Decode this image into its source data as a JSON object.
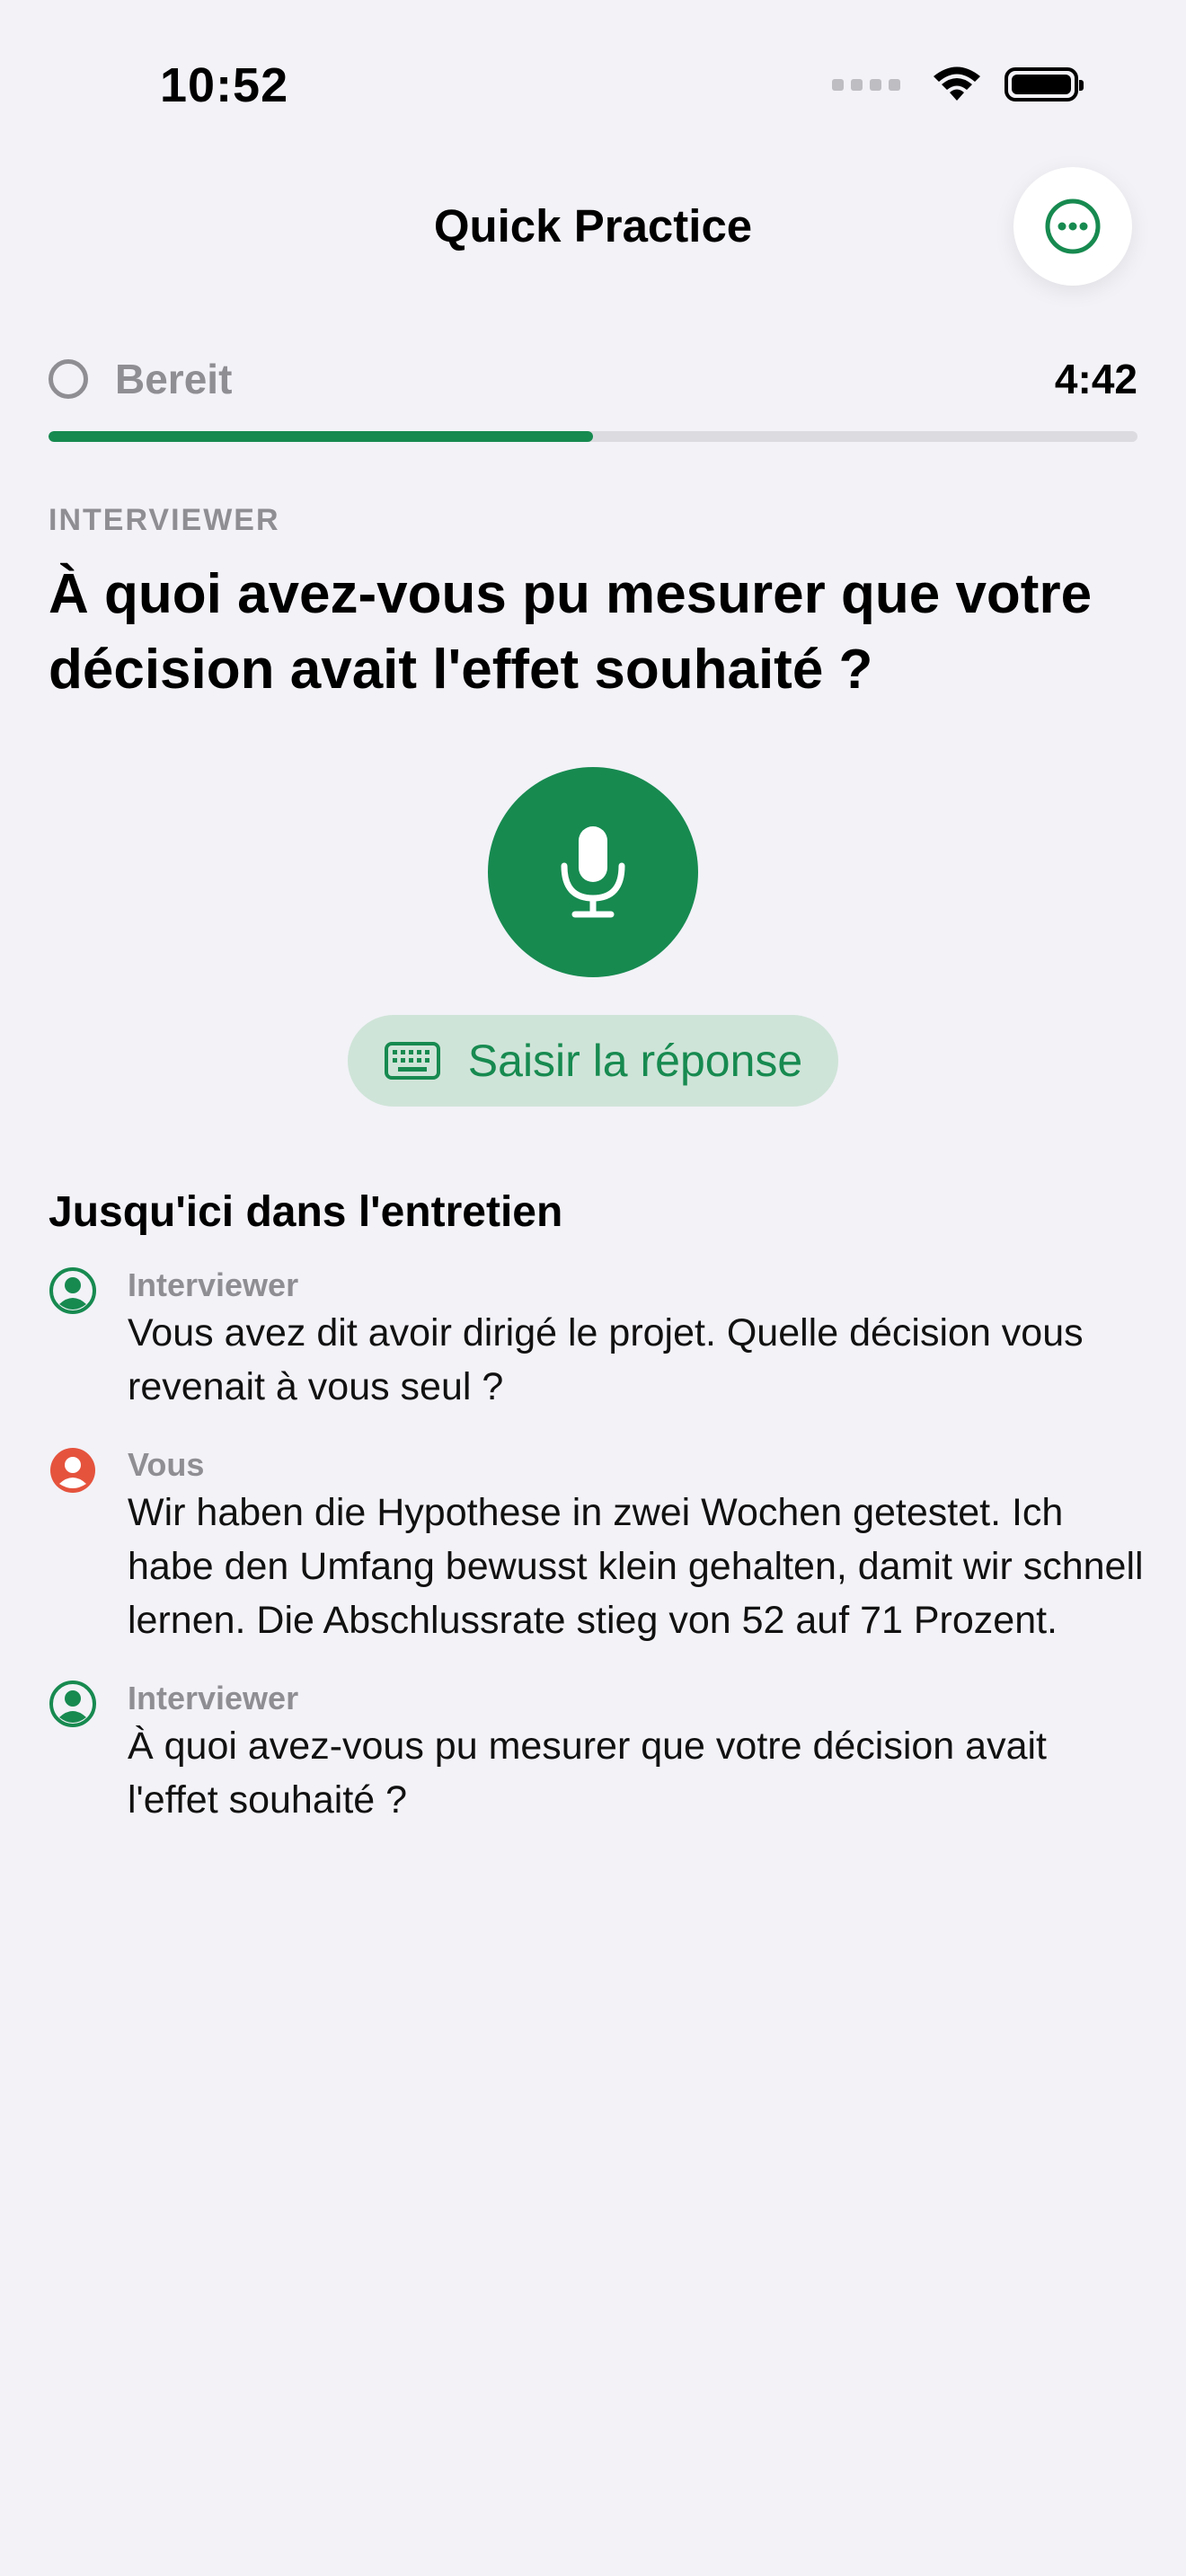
{
  "status_bar": {
    "time": "10:52"
  },
  "nav": {
    "title": "Quick Practice"
  },
  "session": {
    "status": "Bereit",
    "timer": "4:42",
    "progress_percent": 50
  },
  "question": {
    "caption": "INTERVIEWER",
    "text": "À quoi avez-vous pu mesurer que votre décision avait l'effet souhaité ?"
  },
  "actions": {
    "type_answer_label": "Saisir la réponse"
  },
  "transcript": {
    "title": "Jusqu'ici dans l'entretien",
    "entries": [
      {
        "speaker": "Interviewer",
        "text": "Vous avez dit avoir dirigé le projet. Quelle décision vous revenait à vous seul ?"
      },
      {
        "speaker": "Vous",
        "text": "Wir haben die Hypothese in zwei Wochen getestet. Ich habe den Umfang bewusst klein gehalten, damit wir schnell lernen. Die Abschlussrate stieg von 52 auf 71 Prozent."
      },
      {
        "speaker": "Interviewer",
        "text": "À quoi avez-vous pu mesurer que votre décision avait l'effet souhaité ?"
      }
    ]
  },
  "colors": {
    "accent": "#178a50",
    "user": "#e5533d",
    "secondary": "#8e8e93",
    "background": "#f2f2f7"
  },
  "icons": {
    "more": "ellipsis-circle-icon",
    "mic": "microphone-icon",
    "keyboard": "keyboard-icon",
    "avatar": "person-circle-icon"
  }
}
